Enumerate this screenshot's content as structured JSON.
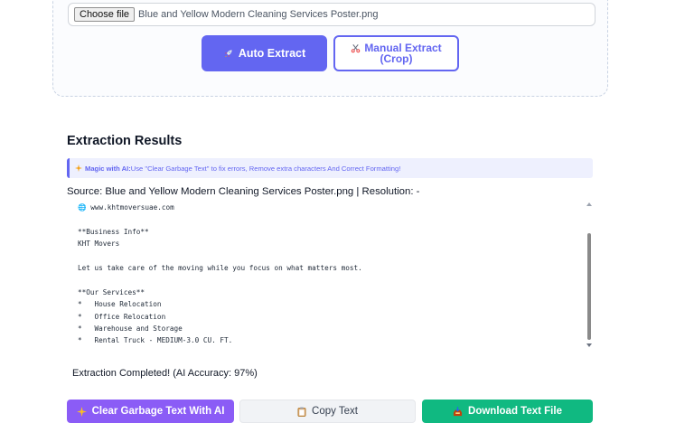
{
  "upload": {
    "choose_label": "Choose file",
    "file_name": "Blue and Yellow Modern Cleaning Services Poster.png",
    "auto_extract_label": "Auto Extract",
    "manual_extract_line1": "Manual Extract",
    "manual_extract_line2": "(Crop)"
  },
  "results": {
    "title": "Extraction Results",
    "banner_title": "Magic with AI:",
    "banner_text": " Use \"Clear Garbage Text\" to fix errors, Remove extra characters And Correct Formatting!",
    "source_line": "Source: Blue and Yellow Modern Cleaning Services Poster.png | Resolution: -",
    "extracted_text": "🌐 www.khtmoversuae.com\n\n**Business Info**\nKHT Movers\n\nLet us take care of the moving while you focus on what matters most.\n\n**Our Services**\n*   House Relocation\n*   Office Relocation\n*   Warehouse and Storage\n*   Rental Truck - MEDIUM-3.0 CU. FT.",
    "status": "Extraction Completed! (AI Accuracy: 97%)"
  },
  "actions": {
    "clear_label": "Clear Garbage Text With AI",
    "copy_label": "Copy Text",
    "download_label": "Download Text File"
  },
  "colors": {
    "primary": "#6366f1",
    "clear": "#8b5cf6",
    "download": "#10b981"
  },
  "icons": {
    "auto": "rocket-icon",
    "manual": "scissors-icon",
    "banner": "sparkles-icon",
    "clear": "sparkles-icon",
    "copy": "clipboard-icon",
    "download": "inbox-tray-icon"
  }
}
